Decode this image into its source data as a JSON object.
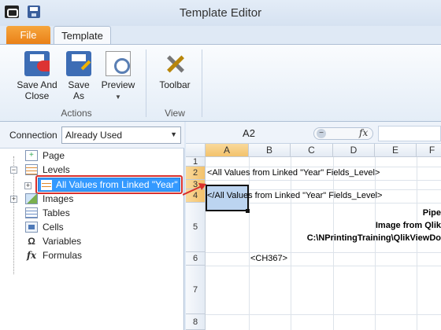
{
  "window": {
    "title": "Template Editor"
  },
  "tabs": {
    "file": "File",
    "template": "Template"
  },
  "ribbon": {
    "actions": {
      "label": "Actions",
      "save_close": [
        "Save And",
        "Close"
      ],
      "save_as": [
        "Save",
        "As"
      ],
      "preview": "Preview"
    },
    "view": {
      "label": "View",
      "toolbar": "Toolbar"
    }
  },
  "connection": {
    "label": "Connection",
    "value": "Already Used"
  },
  "tree": {
    "page": "Page",
    "levels": "Levels",
    "selected_level": "All Values from Linked \"Year\"",
    "images": "Images",
    "tables": "Tables",
    "cells": "Cells",
    "variables": "Variables",
    "formulas": "Formulas"
  },
  "formula_bar": {
    "name_box": "A2",
    "fx": "fx"
  },
  "sheet": {
    "columns": [
      "A",
      "B",
      "C",
      "D",
      "E",
      "F"
    ],
    "rows": [
      "1",
      "2",
      "3",
      "4",
      "5",
      "6",
      "7",
      "8"
    ],
    "cells": {
      "row2": "<All Values from Linked \"Year\" Fields_Level>",
      "row4": "</All Values from Linked \"Year\" Fields_Level>",
      "row5_line1": "Pipe",
      "row5_line2": "Image from Qlik",
      "row5_line3": "C:\\NPrintingTraining\\QlikViewDo",
      "row6_b": "<CH367>"
    }
  },
  "colors": {
    "accent_file": "#e97f16",
    "selection": "#3399ff",
    "highlight_border": "#d9302c"
  }
}
